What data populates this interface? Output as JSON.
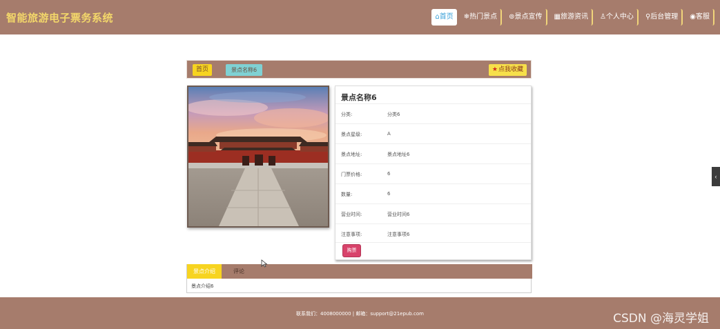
{
  "header": {
    "title": "智能旅游电子票务系统",
    "nav": [
      {
        "icon": "home-icon",
        "glyph": "⌂",
        "label": "首页",
        "active": true
      },
      {
        "icon": "snowflake-icon",
        "glyph": "❄",
        "label": "热门景点"
      },
      {
        "icon": "globe-icon",
        "glyph": "⊚",
        "label": "景点宣传"
      },
      {
        "icon": "grid-icon",
        "glyph": "▦",
        "label": "旅游资讯"
      },
      {
        "icon": "user-icon",
        "glyph": "♙",
        "label": "个人中心"
      },
      {
        "icon": "link-icon",
        "glyph": "⚲",
        "label": "后台管理"
      },
      {
        "icon": "service-icon",
        "glyph": "◉",
        "label": "客服"
      }
    ]
  },
  "breadcrumb": {
    "home": "首页",
    "current": "景点名称6",
    "favorite": "点我收藏"
  },
  "detail": {
    "name": "景点名称6",
    "rows": [
      {
        "label": "分类:",
        "value": "分类6"
      },
      {
        "label": "景点星级:",
        "value": "A"
      },
      {
        "label": "景点地址:",
        "value": "景点地址6"
      },
      {
        "label": "门票价格:",
        "value": "6"
      },
      {
        "label": "数量:",
        "value": "6"
      },
      {
        "label": "营业时间:",
        "value": "营业时间6"
      },
      {
        "label": "注意事项:",
        "value": "注意事项6"
      }
    ],
    "buy": "购票"
  },
  "tabs": {
    "items": [
      "景点介绍",
      "评论"
    ],
    "content": "景点介绍6"
  },
  "footer": {
    "contact": "联系我们：4008000000 | 邮箱：support@21epub.com",
    "watermark": "CSDN @海灵学姐"
  },
  "colors": {
    "brand": "#a67c6c",
    "accent": "#f7d420",
    "buy": "#d8436b"
  }
}
